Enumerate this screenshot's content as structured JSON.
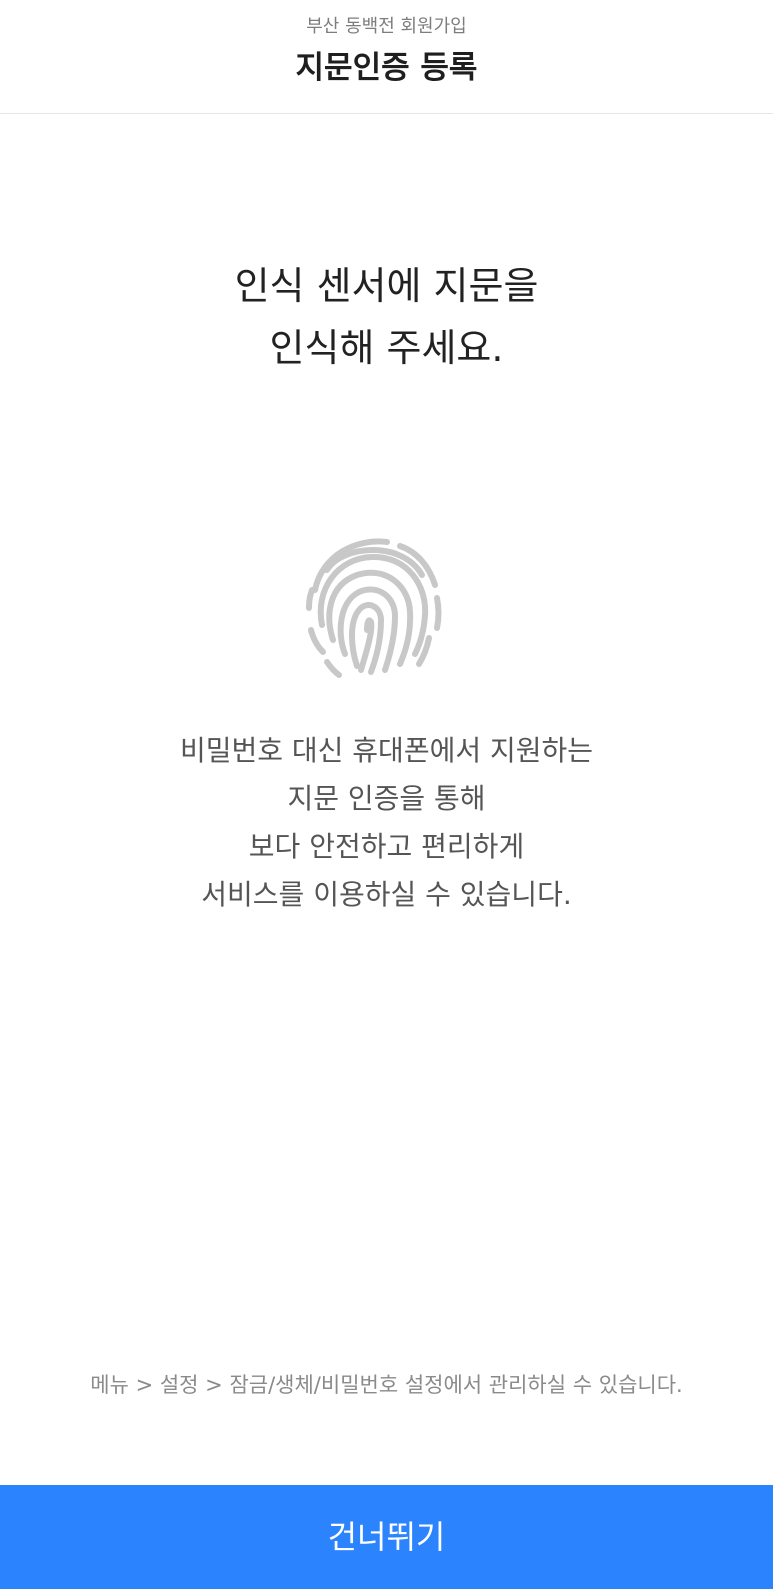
{
  "header": {
    "subtitle": "부산 동백전 회원가입",
    "title": "지문인증 등록"
  },
  "instruction": {
    "lines": [
      "인식 센서에 지문을",
      "인식해 주세요."
    ]
  },
  "fingerprint": {
    "icon": "fingerprint-icon",
    "color": "#c8c8c8"
  },
  "description": {
    "lines": [
      "비밀번호 대신 휴대폰에서 지원하는",
      "지문 인증을 통해",
      "보다 안전하고 편리하게",
      "서비스를 이용하실 수 있습니다."
    ]
  },
  "footnote": "메뉴 > 설정 > 잠금/생체/비밀번호 설정에서 관리하실 수 있습니다.",
  "skip_button": {
    "label": "건너뛰기",
    "color": "#2b84fd"
  }
}
